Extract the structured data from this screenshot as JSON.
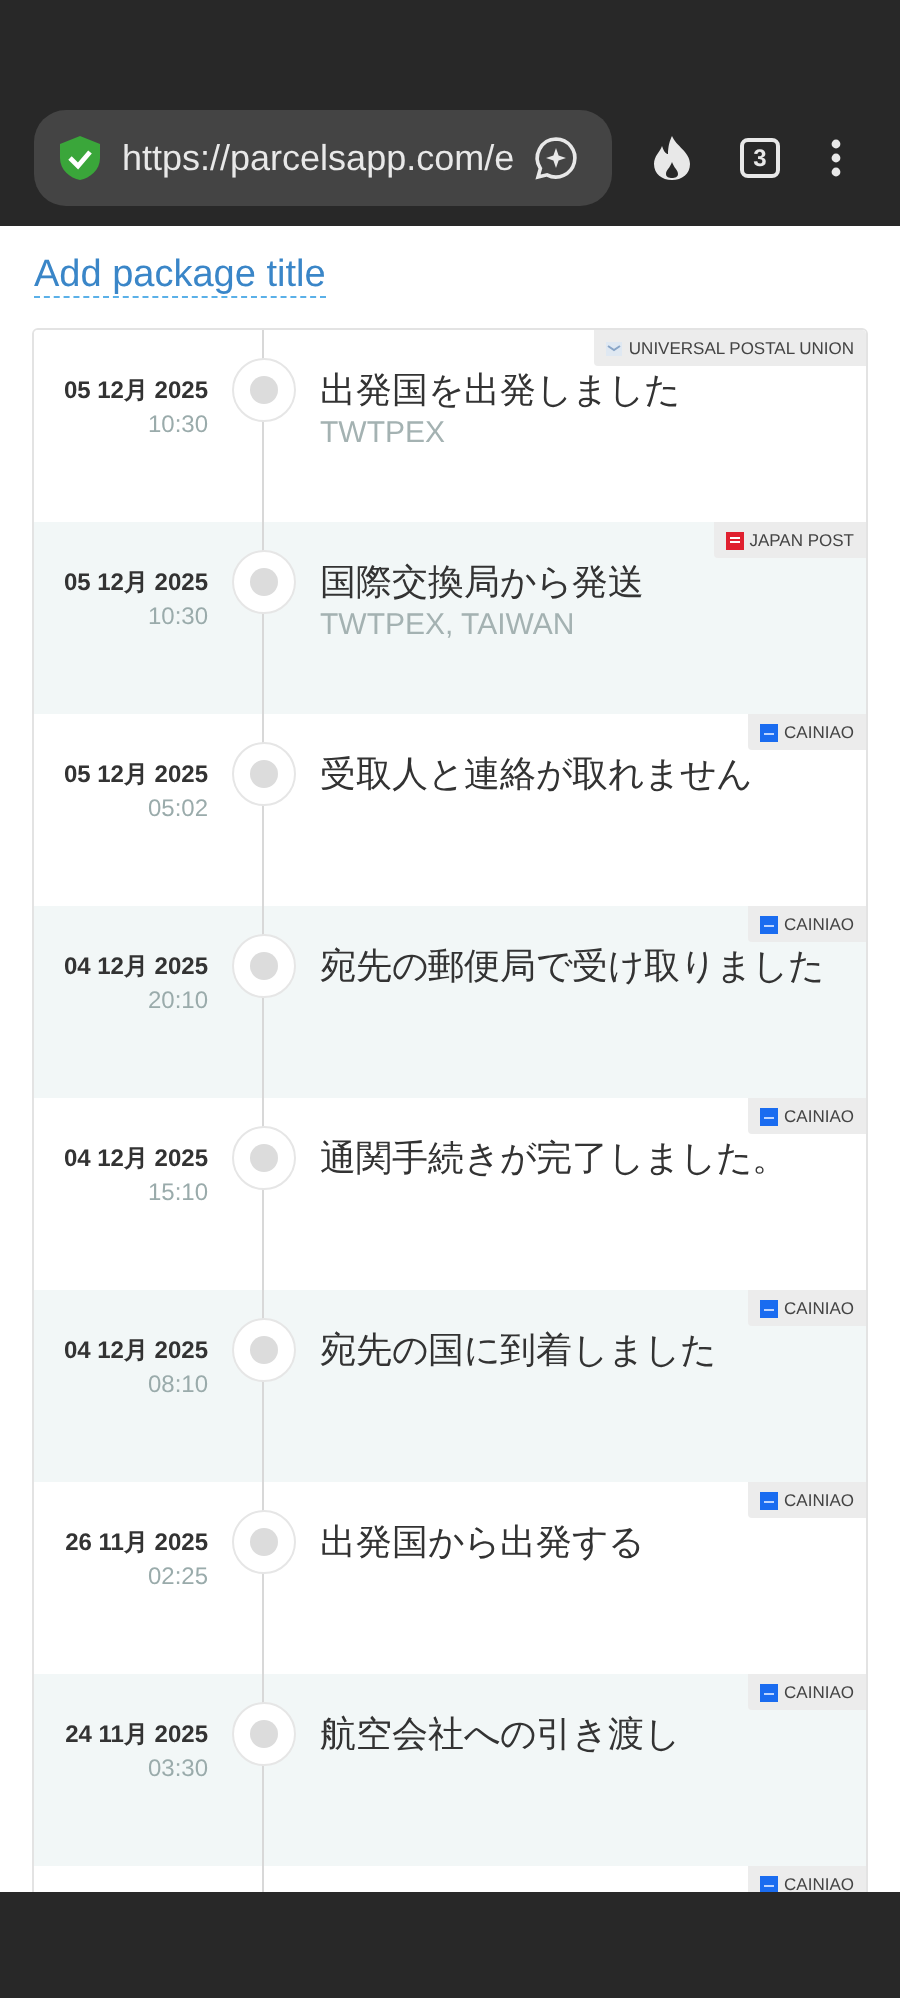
{
  "browser": {
    "url": "https://parcelsapp.com/e",
    "tab_count": "3"
  },
  "title_link": "Add package title",
  "events": [
    {
      "date": "05 12月 2025",
      "time": "10:30",
      "status": "出発国を出発しました",
      "location": "TWTPEX",
      "carrier": "UNIVERSAL POSTAL UNION",
      "kind": "upu"
    },
    {
      "date": "05 12月 2025",
      "time": "10:30",
      "status": "国際交換局から発送",
      "location": "TWTPEX, TAIWAN",
      "carrier": "JAPAN POST",
      "kind": "japanpost"
    },
    {
      "date": "05 12月 2025",
      "time": "05:02",
      "status": "受取人と連絡が取れません",
      "carrier": "CAINIAO",
      "kind": "cainiao"
    },
    {
      "date": "04 12月 2025",
      "time": "20:10",
      "status": "宛先の郵便局で受け取りました",
      "carrier": "CAINIAO",
      "kind": "cainiao"
    },
    {
      "date": "04 12月 2025",
      "time": "15:10",
      "status": "通関手続きが完了しました。",
      "carrier": "CAINIAO",
      "kind": "cainiao"
    },
    {
      "date": "04 12月 2025",
      "time": "08:10",
      "status": "宛先の国に到着しました",
      "carrier": "CAINIAO",
      "kind": "cainiao"
    },
    {
      "date": "26 11月 2025",
      "time": "02:25",
      "status": "出発国から出発する",
      "carrier": "CAINIAO",
      "kind": "cainiao"
    },
    {
      "date": "24 11月 2025",
      "time": "03:30",
      "status": "航空会社への引き渡し",
      "carrier": "CAINIAO",
      "kind": "cainiao"
    },
    {
      "carrier": "CAINIAO",
      "kind": "cainiao"
    }
  ]
}
